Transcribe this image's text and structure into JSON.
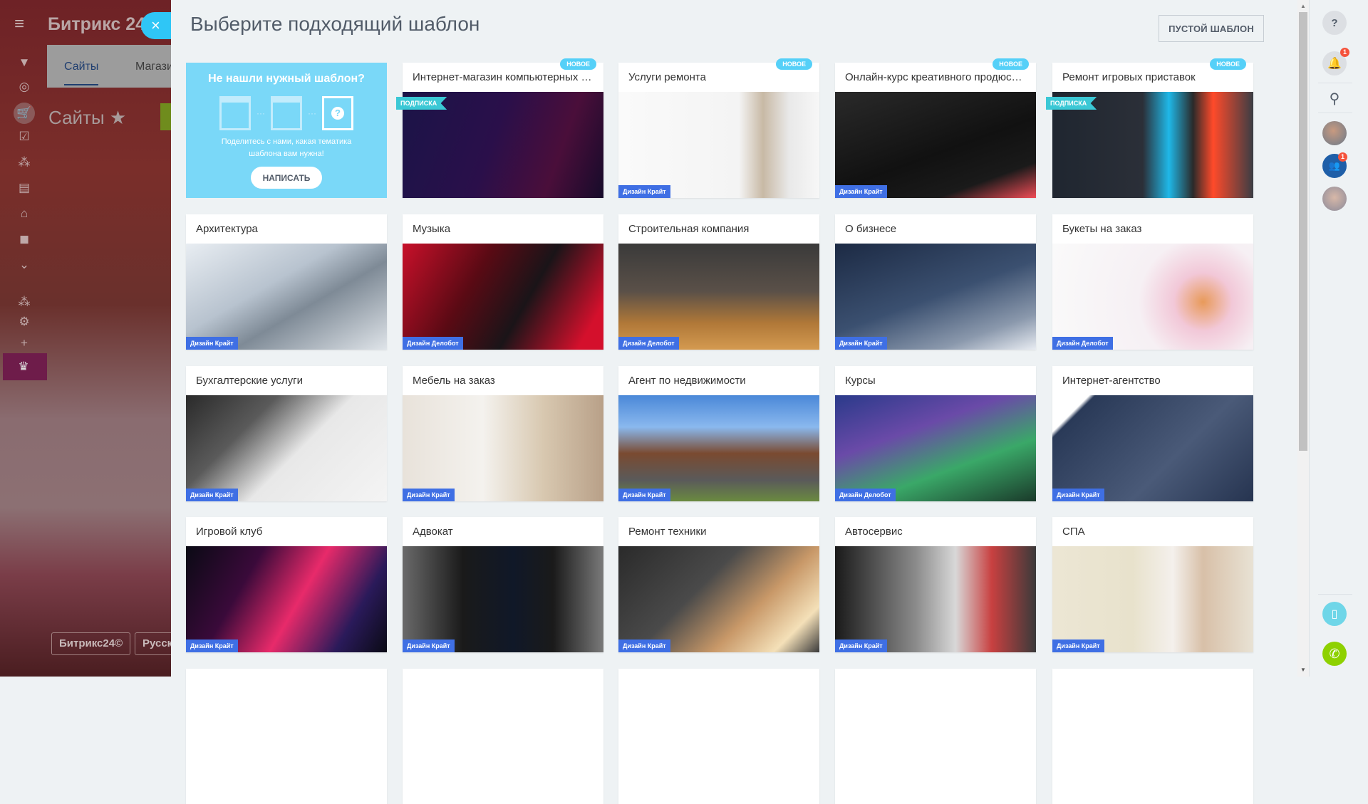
{
  "background": {
    "logo": "Битрикс 24",
    "tabs": [
      "Сайты",
      "Магази"
    ],
    "page_title": "Сайты",
    "footer": [
      "Битрикс24©",
      "Русск"
    ]
  },
  "panel": {
    "title": "Выберите подходящий шаблон",
    "empty_template_label": "ПУСТОЙ ШАБЛОН",
    "close_icon": "×",
    "promo": {
      "heading": "Не нашли нужный шаблон?",
      "text": "Поделитесь с нами, какая тематика шаблона вам нужна!",
      "button": "НАПИСАТЬ",
      "dots": "···",
      "question": "?"
    },
    "labels": {
      "new": "НОВОЕ",
      "subscription": "ПОДПИСКА"
    },
    "cards": [
      {
        "title": "Интернет-магазин компьютерных игр",
        "new": true,
        "sub": true,
        "designer": "",
        "bg": "linear-gradient(110deg,#1b1448 0%,#2a0f4a 45%,#4a0e3a 75%,#160b2a 100%)"
      },
      {
        "title": "Услуги ремонта",
        "new": true,
        "sub": false,
        "designer": "Дизайн Крайт",
        "bg": "linear-gradient(90deg,#fafafa 0%,#f4f4f4 60%,#c8b9a5 72%,#e9e9e9 85%,#f7f7f7 100%)"
      },
      {
        "title": "Онлайн-курс креативного продюсера",
        "new": true,
        "sub": false,
        "designer": "Дизайн Крайт",
        "bg": "linear-gradient(160deg,#2a2a2a 0%,#111 55%,#1a1a1a 80%,#f04b55 100%)"
      },
      {
        "title": "Ремонт игровых приставок",
        "new": true,
        "sub": true,
        "designer": "",
        "bg": "linear-gradient(90deg,#1f2630 0%,#2b2f38 45%,#1fb8e8 58%,#2a2a2a 70%,#ff4a2a 80%,#3a3d44 100%)"
      },
      {
        "title": "Архитектура",
        "designer": "Дизайн Крайт",
        "bg": "linear-gradient(150deg,#e8edf2 0%,#b8c3cf 40%,#7e8a96 60%,#dfe4e9 100%)"
      },
      {
        "title": "Музыка",
        "designer": "Дизайн Делобот",
        "bg": "linear-gradient(120deg,#c8102a 0%,#5a0a14 35%,#1a1418 60%,#d4102c 90%)"
      },
      {
        "title": "Строительная компания",
        "designer": "Дизайн Делобот",
        "bg": "linear-gradient(180deg,#3a3a3a 0%,#5a5048 45%,#b07838 75%,#d49a50 100%)"
      },
      {
        "title": "О бизнесе",
        "designer": "Дизайн Крайт",
        "bg": "linear-gradient(160deg,#1c2a44 0%,#3b5070 50%,#8a98ac 80%,#e8ecf2 100%)"
      },
      {
        "title": "Букеты на заказ",
        "designer": "Дизайн Делобот",
        "bg": "radial-gradient(circle at 75% 55%,#e89a5a 0%,#f2c8d8 18%,#f6f0f4 40%,#fafafa 100%)"
      },
      {
        "title": "Бухгалтерские услуги",
        "designer": "Дизайн Крайт",
        "bg": "linear-gradient(135deg,#2a2a2a 0%,#5a5a5a 30%,#e8e8e8 55%,#f4f4f4 100%)"
      },
      {
        "title": "Мебель на заказ",
        "designer": "Дизайн Крайт",
        "bg": "linear-gradient(90deg,#e8e2da 0%,#f4f2ee 40%,#d8c8b0 70%,#b8a088 100%)"
      },
      {
        "title": "Агент по недвижимости",
        "designer": "Дизайн Крайт",
        "bg": "linear-gradient(180deg,#4a88d8 0%,#8ab8ee 30%,#7a4a30 55%,#5a5a5a 80%,#6a8a40 100%)"
      },
      {
        "title": "Курсы",
        "designer": "Дизайн Делобот",
        "bg": "linear-gradient(160deg,#2a3a8a 0%,#6a4aa8 35%,#3aa868 65%,#1a3a2a 100%)"
      },
      {
        "title": "Интернет-агентство",
        "designer": "Дизайн Крайт",
        "bg": "linear-gradient(135deg,#ffffff 0%,#ffffff 12%,#2a3a58 14%,#4a5a78 60%,#263450 100%)"
      },
      {
        "title": "Игровой клуб",
        "designer": "Дизайн Крайт",
        "bg": "linear-gradient(120deg,#0a0a14 0%,#3a0a3a 30%,#e82a6a 55%,#2a1a5a 80%,#0a0a14 100%)"
      },
      {
        "title": "Адвокат",
        "designer": "Дизайн Крайт",
        "bg": "linear-gradient(90deg,#6a6a6a 0%,#1a1a1a 30%,#101828 55%,#1a1a1a 75%,#7a7a7a 100%)"
      },
      {
        "title": "Ремонт техники",
        "designer": "Дизайн Крайт",
        "bg": "linear-gradient(135deg,#2a2a2a 0%,#4a4a4a 40%,#c89868 65%,#f4e0b8 85%,#3a3a3a 100%)"
      },
      {
        "title": "Автосервис",
        "designer": "Дизайн Крайт",
        "bg": "linear-gradient(90deg,#1a1a1a 0%,#8a8a8a 40%,#d8d8d8 60%,#c84040 78%,#3a3a3a 100%)"
      },
      {
        "title": "СПА",
        "designer": "Дизайн Крайт",
        "bg": "linear-gradient(90deg,#ece6d4 0%,#e8e2cc 40%,#f4f0ec 60%,#d8c0a8 75%,#e8e2d4 100%)"
      },
      {
        "title": "",
        "designer": "",
        "bg": "#ffffff"
      },
      {
        "title": "",
        "designer": "",
        "bg": "#ffffff"
      },
      {
        "title": "",
        "designer": "",
        "bg": "#ffffff"
      },
      {
        "title": "",
        "designer": "",
        "bg": "#ffffff"
      },
      {
        "title": "",
        "designer": "",
        "bg": "#ffffff"
      }
    ]
  },
  "right_bar": {
    "help_icon": "?",
    "notifications_count": "1",
    "chat_count": "1"
  },
  "colors": {
    "accent": "#2fc6f6",
    "promo": "#7ad8f8",
    "designer": "#3f6fe4",
    "new": "#55d0f8",
    "ribbon": "#3bc8d5"
  }
}
